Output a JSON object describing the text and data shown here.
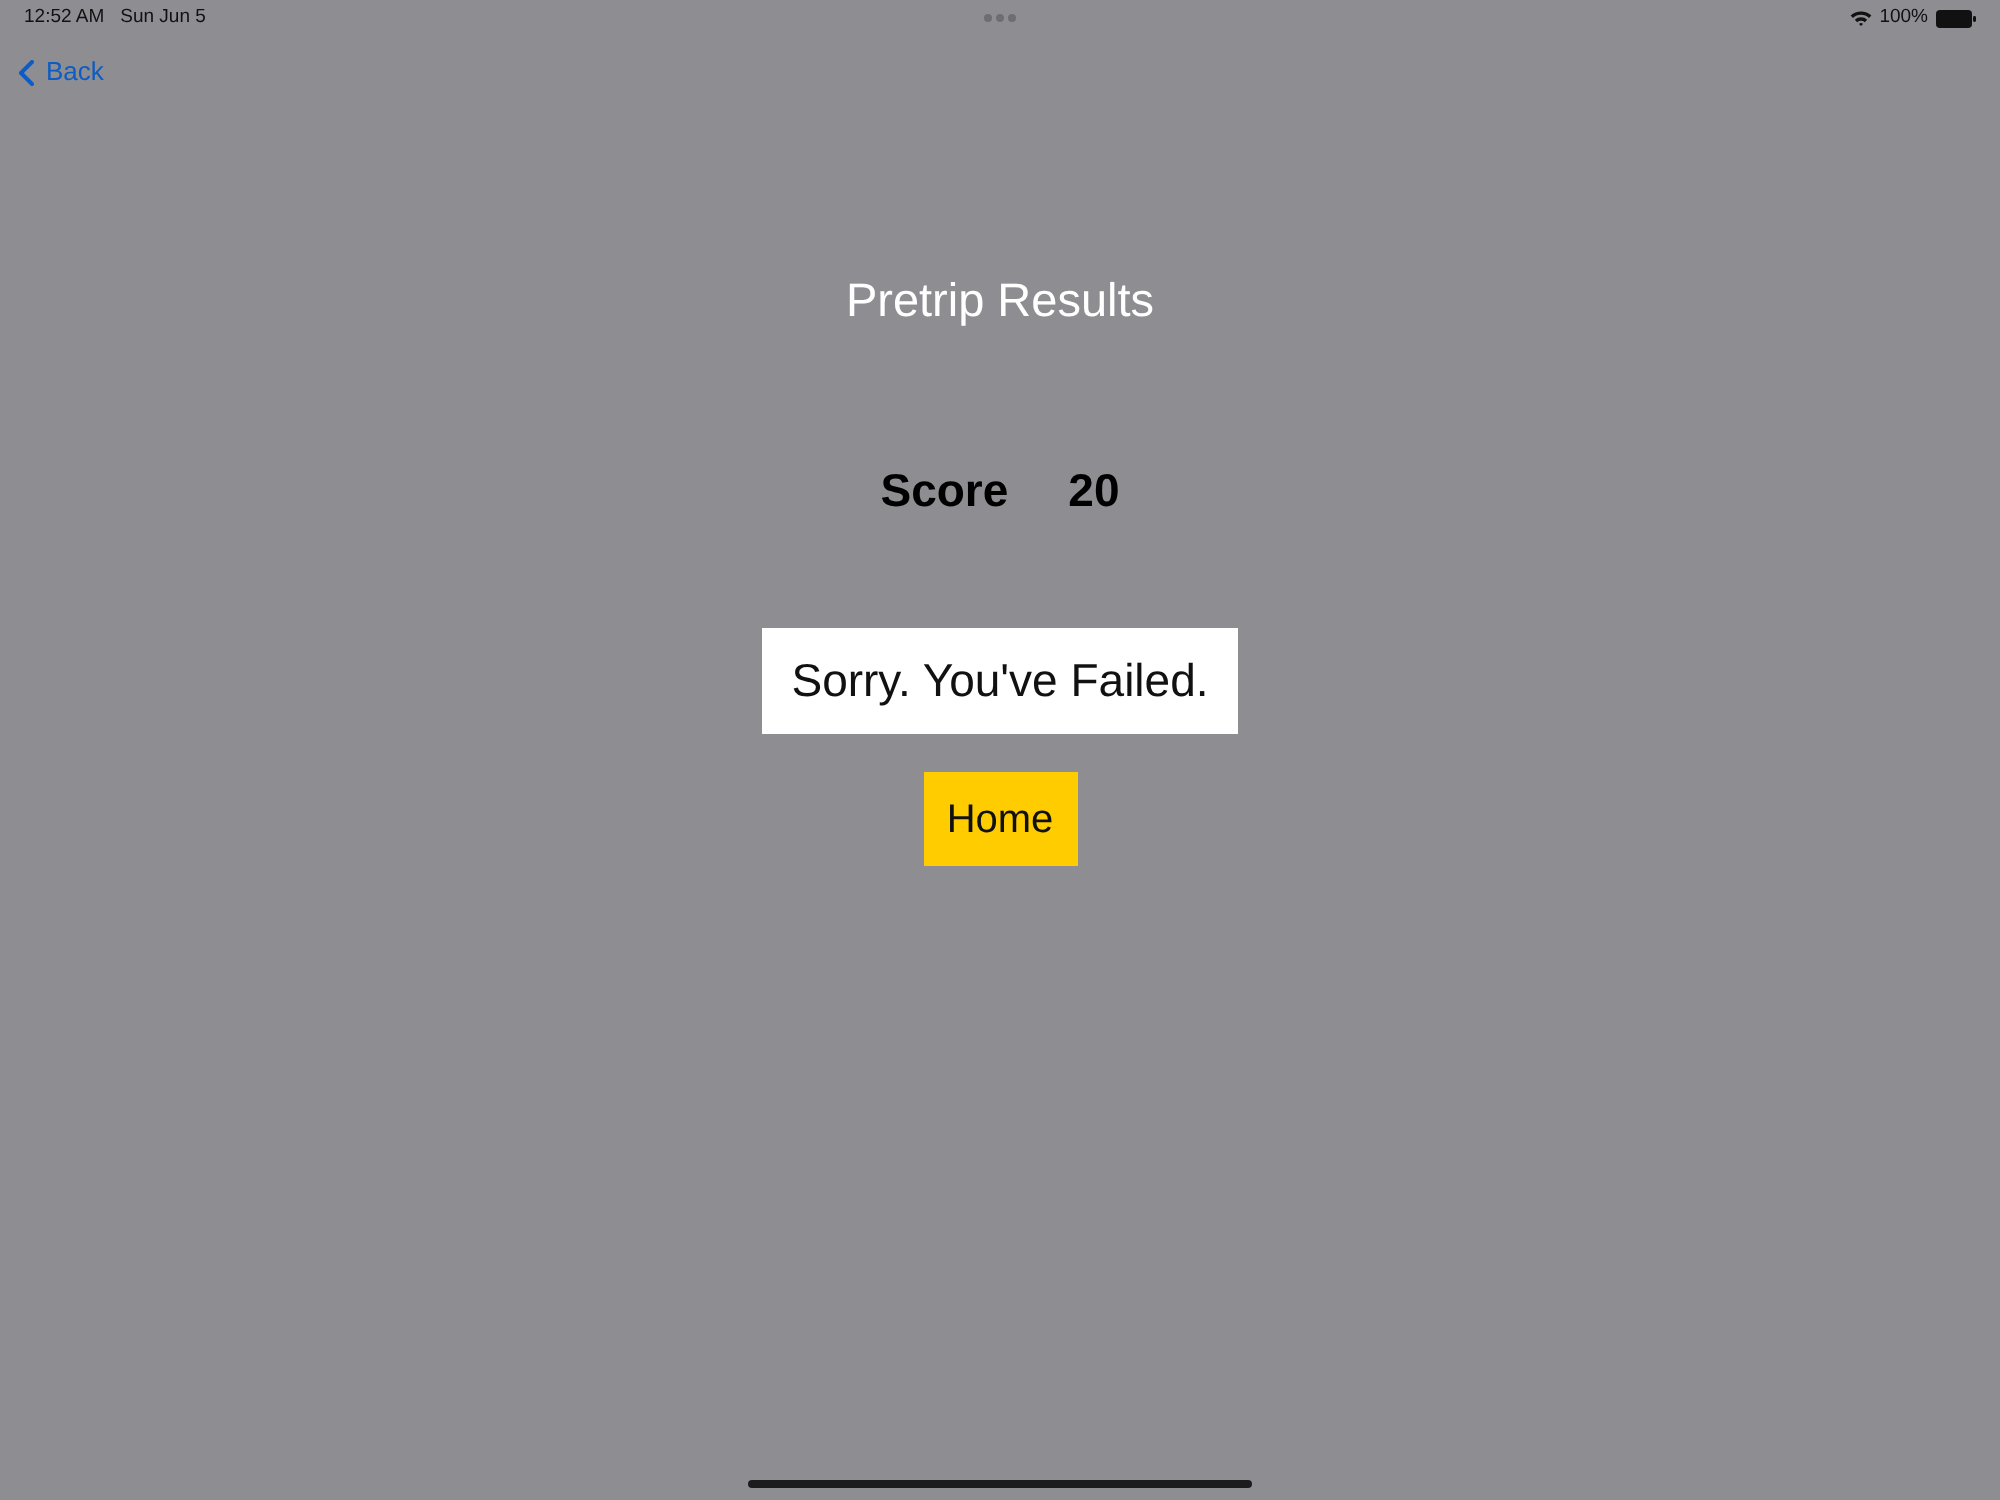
{
  "status_bar": {
    "time": "12:52 AM",
    "date": "Sun Jun 5",
    "battery": "100%"
  },
  "nav": {
    "back": "Back"
  },
  "title": "Pretrip Results",
  "score": {
    "label": "Score",
    "value": "20"
  },
  "message": "Sorry. You've Failed.",
  "buttons": [
    {
      "label": "Home"
    }
  ]
}
